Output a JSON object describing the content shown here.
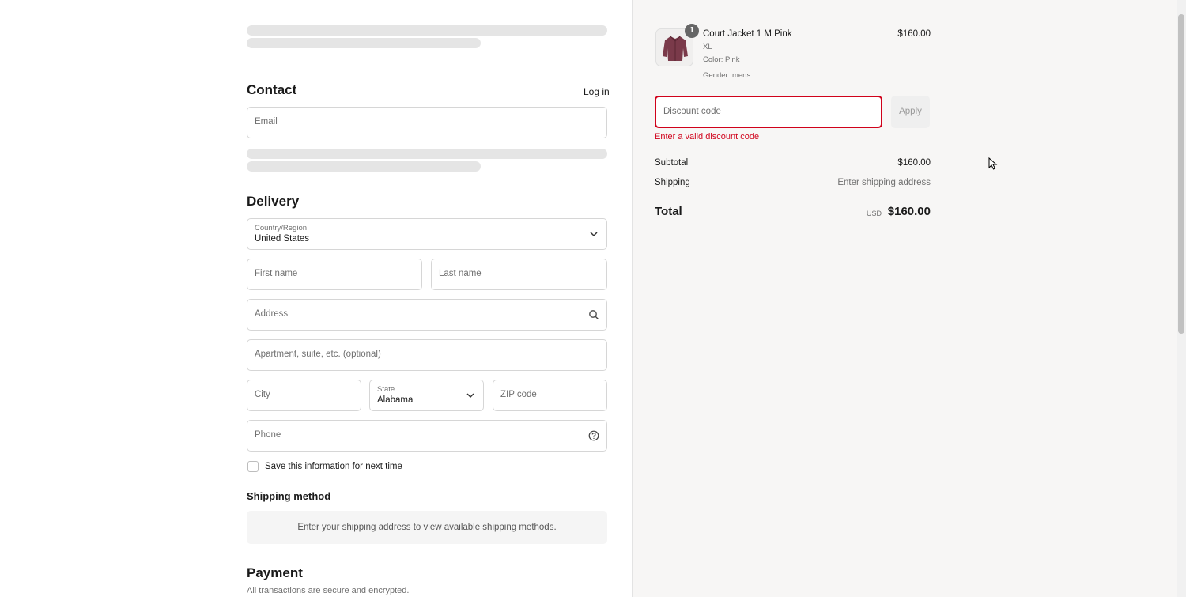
{
  "contact": {
    "heading": "Contact",
    "login_label": "Log in",
    "email_placeholder": "Email"
  },
  "delivery": {
    "heading": "Delivery",
    "country_label": "Country/Region",
    "country_value": "United States",
    "first_name_placeholder": "First name",
    "last_name_placeholder": "Last name",
    "address_placeholder": "Address",
    "apartment_placeholder": "Apartment, suite, etc. (optional)",
    "city_placeholder": "City",
    "state_label": "State",
    "state_value": "Alabama",
    "zip_placeholder": "ZIP code",
    "phone_placeholder": "Phone",
    "save_info_label": "Save this information for next time"
  },
  "shipping_method": {
    "heading": "Shipping method",
    "message": "Enter your shipping address to view available shipping methods."
  },
  "payment": {
    "heading": "Payment",
    "subtitle": "All transactions are secure and encrypted."
  },
  "summary": {
    "item": {
      "quantity": "1",
      "name": "Court Jacket 1 M Pink",
      "size": "XL",
      "color": "Color: Pink",
      "gender": "Gender: mens",
      "price": "$160.00"
    },
    "discount_placeholder": "Discount code",
    "apply_label": "Apply",
    "discount_error": "Enter a valid discount code",
    "subtotal_label": "Subtotal",
    "subtotal_value": "$160.00",
    "shipping_label": "Shipping",
    "shipping_value": "Enter shipping address",
    "total_label": "Total",
    "total_currency": "USD",
    "total_value": "$160.00"
  },
  "colors": {
    "error": "#d0021b",
    "summary_bg": "#f7f6f5",
    "skeleton": "#e5e5e5"
  },
  "icons": {
    "country_dropdown": "chevron-down-icon",
    "address_search": "search-icon",
    "state_dropdown": "chevron-down-icon",
    "phone_help": "question-circle-icon"
  }
}
